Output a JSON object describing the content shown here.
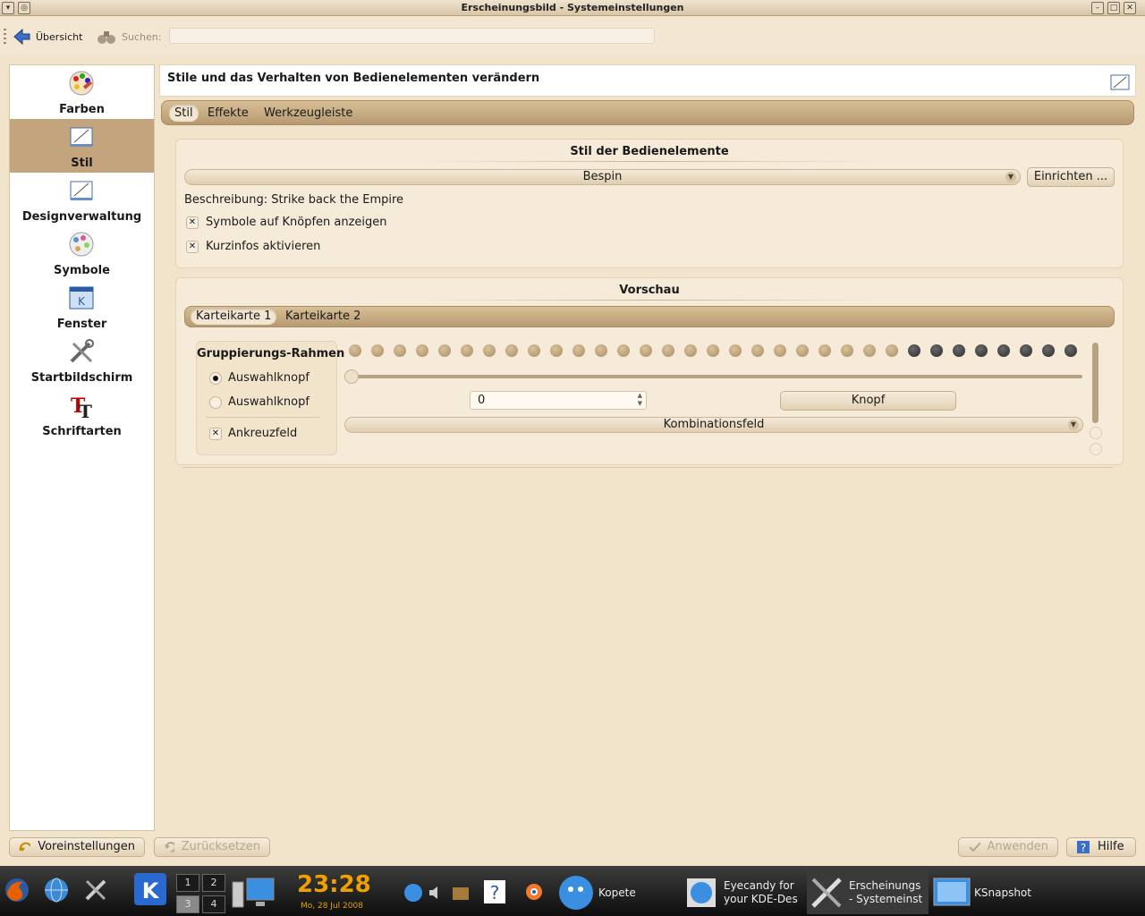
{
  "window": {
    "title": "Erscheinungsbild - Systemeinstellungen"
  },
  "toolbar": {
    "back_label": "Übersicht",
    "search_label": "Suchen:",
    "search_value": ""
  },
  "sidebar": {
    "items": [
      {
        "label": "Farben",
        "icon": "palette-icon"
      },
      {
        "label": "Stil",
        "icon": "style-icon"
      },
      {
        "label": "Designverwaltung",
        "icon": "theme-manager-icon"
      },
      {
        "label": "Symbole",
        "icon": "icons-icon"
      },
      {
        "label": "Fenster",
        "icon": "window-icon"
      },
      {
        "label": "Startbildschirm",
        "icon": "splash-screen-icon"
      },
      {
        "label": "Schriftarten",
        "icon": "fonts-icon"
      }
    ],
    "selected": "Stil"
  },
  "main": {
    "heading": "Stile und das Verhalten von Bedienelementen verändern",
    "tabs": [
      "Stil",
      "Effekte",
      "Werkzeugleiste"
    ],
    "widget_style": {
      "title": "Stil der Bedienelemente",
      "selected_style": "Bespin",
      "configure_label": "Einrichten ...",
      "description": "Beschreibung: Strike back the Empire",
      "show_icons_label": "Symbole auf Knöpfen anzeigen",
      "show_icons_checked": true,
      "tooltips_label": "Kurzinfos aktivieren",
      "tooltips_checked": true
    },
    "preview": {
      "title": "Vorschau",
      "tabs": [
        "Karteikarte 1",
        "Karteikarte 2"
      ],
      "group_title": "Gruppierungs-Rahmen",
      "radio1": "Auswahlknopf",
      "radio1_checked": true,
      "radio2": "Auswahlknopf",
      "radio2_checked": false,
      "checkbox": "Ankreuzfeld",
      "checkbox_checked": true,
      "progress_filled_fraction": 0.25,
      "spin_value": "0",
      "button_label": "Knopf",
      "combo_value": "Kombinationsfeld"
    }
  },
  "bottom": {
    "defaults_label": "Voreinstellungen",
    "reset_label": "Zurücksetzen",
    "apply_label": "Anwenden",
    "help_label": "Hilfe"
  },
  "taskbar": {
    "time": "23:28",
    "date": "Mo, 28 Jul 2008",
    "desktops": [
      "1",
      "2",
      "3",
      "4"
    ],
    "tasks": [
      {
        "label": "Kopete"
      },
      {
        "label": "Eyecandy for your KDE-Des"
      },
      {
        "label": "Erscheinungs - Systemeinst"
      },
      {
        "label": "KSnapshot"
      }
    ]
  },
  "colors": {
    "accent": "#c3a47c",
    "background": "#f2e3cb",
    "clock": "#f0a000"
  }
}
